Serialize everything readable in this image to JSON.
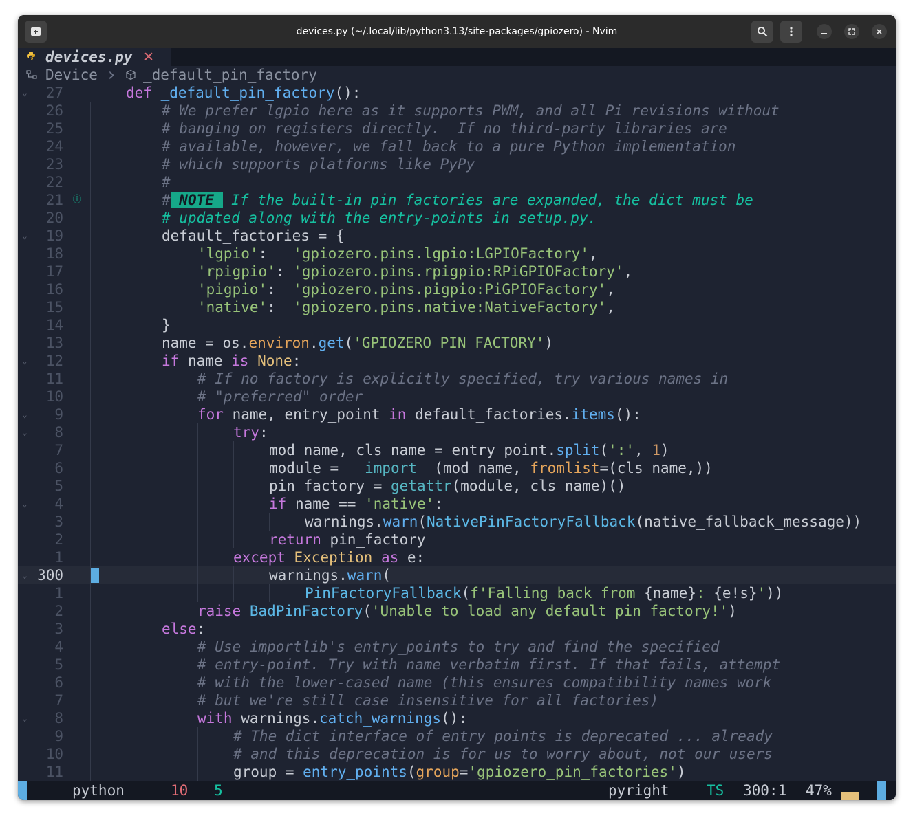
{
  "window": {
    "title": "devices.py (~/.local/lib/python3.13/site-packages/gpiozero) - Nvim",
    "new_tab_icon": "new-tab-icon",
    "search_icon": "search-icon",
    "menu_icon": "kebab-menu-icon",
    "minimize_icon": "minimize-icon",
    "maximize_icon": "maximize-icon",
    "close_icon": "close-icon"
  },
  "tab": {
    "icon": "python-icon",
    "name": "devices.py",
    "close": "✕"
  },
  "winbar": {
    "icon": "class-icon",
    "class_name": "Device",
    "separator": "›",
    "func_icon": "function-icon",
    "func_name": "_default_pin_factory"
  },
  "editor": {
    "current_line": "300",
    "lines": [
      {
        "num": "27",
        "fold": "⌄"
      },
      {
        "num": "26"
      },
      {
        "num": "25"
      },
      {
        "num": "24"
      },
      {
        "num": "23"
      },
      {
        "num": "22"
      },
      {
        "num": "21",
        "sign": "ⓘ"
      },
      {
        "num": "20"
      },
      {
        "num": "19",
        "fold": "⌄"
      },
      {
        "num": "18"
      },
      {
        "num": "17"
      },
      {
        "num": "16"
      },
      {
        "num": "15"
      },
      {
        "num": "14"
      },
      {
        "num": "13"
      },
      {
        "num": "12",
        "fold": "⌄"
      },
      {
        "num": "11"
      },
      {
        "num": "10"
      },
      {
        "num": "9",
        "fold": "⌄"
      },
      {
        "num": "8",
        "fold": "⌄"
      },
      {
        "num": "7"
      },
      {
        "num": "6"
      },
      {
        "num": "5"
      },
      {
        "num": "4",
        "fold": "⌄"
      },
      {
        "num": "3"
      },
      {
        "num": "2"
      },
      {
        "num": "1"
      },
      {
        "num": "300",
        "fold": "⌄",
        "current": true
      },
      {
        "num": "1"
      },
      {
        "num": "2"
      },
      {
        "num": "3"
      },
      {
        "num": "4"
      },
      {
        "num": "5"
      },
      {
        "num": "6"
      },
      {
        "num": "7"
      },
      {
        "num": "8",
        "fold": "⌄"
      },
      {
        "num": "9"
      },
      {
        "num": "10"
      },
      {
        "num": "11"
      }
    ],
    "code": [
      [
        [
          "kw",
          "def "
        ],
        [
          "fn",
          "_default_pin_factory"
        ],
        [
          "",
          "():"
        ]
      ],
      [
        [
          "cm",
          "# We prefer lgpio here as it supports PWM, and all Pi revisions without"
        ]
      ],
      [
        [
          "cm",
          "# banging on registers directly.  If no third-party libraries are"
        ]
      ],
      [
        [
          "cm",
          "# available, however, we fall back to a pure Python implementation"
        ]
      ],
      [
        [
          "cm",
          "# which supports platforms like PyPy"
        ]
      ],
      [
        [
          "cm",
          "#"
        ]
      ],
      [
        [
          "cm",
          "#"
        ],
        [
          "note-tag",
          " NOTE "
        ],
        [
          "note-text",
          " If the built-in pin factories are expanded, the dict must be"
        ]
      ],
      [
        [
          "note-text",
          "# updated along with the entry-points in setup.py."
        ]
      ],
      [
        [
          "",
          "default_factories = {"
        ]
      ],
      [
        [
          "str",
          "'lgpio'"
        ],
        [
          "",
          ":   "
        ],
        [
          "str",
          "'gpiozero.pins.lgpio:LGPIOFactory'"
        ],
        [
          "",
          ","
        ]
      ],
      [
        [
          "str",
          "'rpigpio'"
        ],
        [
          "",
          ": "
        ],
        [
          "str",
          "'gpiozero.pins.rpigpio:RPiGPIOFactory'"
        ],
        [
          "",
          ","
        ]
      ],
      [
        [
          "str",
          "'pigpio'"
        ],
        [
          "",
          ":  "
        ],
        [
          "str",
          "'gpiozero.pins.pigpio:PiGPIOFactory'"
        ],
        [
          "",
          ","
        ]
      ],
      [
        [
          "str",
          "'native'"
        ],
        [
          "",
          ":  "
        ],
        [
          "str",
          "'gpiozero.pins.native:NativeFactory'"
        ],
        [
          "",
          ","
        ]
      ],
      [
        [
          "",
          "}"
        ]
      ],
      [
        [
          "",
          "name = os."
        ],
        [
          "param",
          "environ"
        ],
        [
          "",
          "."
        ],
        [
          "fn",
          "get"
        ],
        [
          "",
          "("
        ],
        [
          "str",
          "'GPIOZERO_PIN_FACTORY'"
        ],
        [
          "",
          ")"
        ]
      ],
      [
        [
          "kw",
          "if"
        ],
        [
          "",
          " name "
        ],
        [
          "kw",
          "is"
        ],
        [
          "",
          " "
        ],
        [
          "cls",
          "None"
        ],
        [
          "",
          ":"
        ]
      ],
      [
        [
          "cm",
          "# If no factory is explicitly specified, try various names in"
        ]
      ],
      [
        [
          "cm",
          "# \"preferred\" order"
        ]
      ],
      [
        [
          "kw",
          "for"
        ],
        [
          "",
          " name, entry_point "
        ],
        [
          "kw",
          "in"
        ],
        [
          "",
          " default_factories."
        ],
        [
          "fn",
          "items"
        ],
        [
          "",
          "():"
        ]
      ],
      [
        [
          "kw",
          "try"
        ],
        [
          "",
          ":"
        ]
      ],
      [
        [
          "",
          "mod_name, cls_name = entry_point."
        ],
        [
          "fn",
          "split"
        ],
        [
          "",
          "("
        ],
        [
          "str",
          "':'"
        ],
        [
          "",
          ", "
        ],
        [
          "num",
          "1"
        ],
        [
          "",
          ")"
        ]
      ],
      [
        [
          "",
          "module = "
        ],
        [
          "bi",
          "__import__"
        ],
        [
          "",
          "(mod_name, "
        ],
        [
          "param",
          "fromlist"
        ],
        [
          "",
          "=(cls_name,))"
        ]
      ],
      [
        [
          "",
          "pin_factory = "
        ],
        [
          "bi",
          "getattr"
        ],
        [
          "",
          "(module, cls_name)()"
        ]
      ],
      [
        [
          "kw",
          "if"
        ],
        [
          "",
          " name == "
        ],
        [
          "str",
          "'native'"
        ],
        [
          "",
          ":"
        ]
      ],
      [
        [
          "",
          "warnings."
        ],
        [
          "fn",
          "warn"
        ],
        [
          "",
          "("
        ],
        [
          "ty",
          "NativePinFactoryFallback"
        ],
        [
          "",
          "(native_fallback_message))"
        ]
      ],
      [
        [
          "kw",
          "return"
        ],
        [
          "",
          " pin_factory"
        ]
      ],
      [
        [
          "kw",
          "except"
        ],
        [
          "",
          " "
        ],
        [
          "cls",
          "Exception"
        ],
        [
          "",
          " "
        ],
        [
          "kw",
          "as"
        ],
        [
          "",
          " e:"
        ]
      ],
      [
        [
          "",
          "warnings."
        ],
        [
          "fn",
          "warn"
        ],
        [
          "",
          "("
        ]
      ],
      [
        [
          "ty",
          "PinFactoryFallback"
        ],
        [
          "",
          "("
        ],
        [
          "str",
          "f'Falling back from "
        ],
        [
          "",
          "{name}"
        ],
        [
          "str",
          ": "
        ],
        [
          "",
          "{e!s}"
        ],
        [
          "str",
          "'"
        ],
        [
          "",
          "))"
        ]
      ],
      [
        [
          "kw",
          "raise"
        ],
        [
          "",
          " "
        ],
        [
          "ty",
          "BadPinFactory"
        ],
        [
          "",
          "("
        ],
        [
          "str",
          "'Unable to load any default pin factory!'"
        ],
        [
          "",
          ")"
        ]
      ],
      [
        [
          "kw",
          "else"
        ],
        [
          "",
          ":"
        ]
      ],
      [
        [
          "cm",
          "# Use importlib's entry_points to try and find the specified"
        ]
      ],
      [
        [
          "cm",
          "# entry-point. Try with name verbatim first. If that fails, attempt"
        ]
      ],
      [
        [
          "cm",
          "# with the lower-cased name (this ensures compatibility names work"
        ]
      ],
      [
        [
          "cm",
          "# but we're still case insensitive for all factories)"
        ]
      ],
      [
        [
          "kw",
          "with"
        ],
        [
          "",
          " warnings."
        ],
        [
          "fn",
          "catch_warnings"
        ],
        [
          "",
          "():"
        ]
      ],
      [
        [
          "cm",
          "# The dict interface of entry_points is deprecated ... already"
        ]
      ],
      [
        [
          "cm",
          "# and this deprecation is for us to worry about, not our users"
        ]
      ],
      [
        [
          "",
          "group = "
        ],
        [
          "fn",
          "entry_points"
        ],
        [
          "",
          "("
        ],
        [
          "param",
          "group"
        ],
        [
          "",
          "="
        ],
        [
          "str",
          "'gpiozero_pin_factories'"
        ],
        [
          "",
          ")"
        ]
      ]
    ]
  },
  "statusline": {
    "filetype_icon": "python-icon",
    "filetype": "python",
    "error_icon": "error-icon",
    "errors": "10",
    "hint_icon": "lightbulb-icon",
    "hints": "5",
    "lsp_icon": "gears-icon",
    "lsp": "pyright",
    "ts_icon": "treesitter-icon",
    "ts": "TS",
    "position": "300:1",
    "percent": "47%",
    "colors": {
      "accent": "#5dade2",
      "error": "#e06c75",
      "hint": "#16c0a0",
      "progress": "#e5c07b"
    }
  }
}
